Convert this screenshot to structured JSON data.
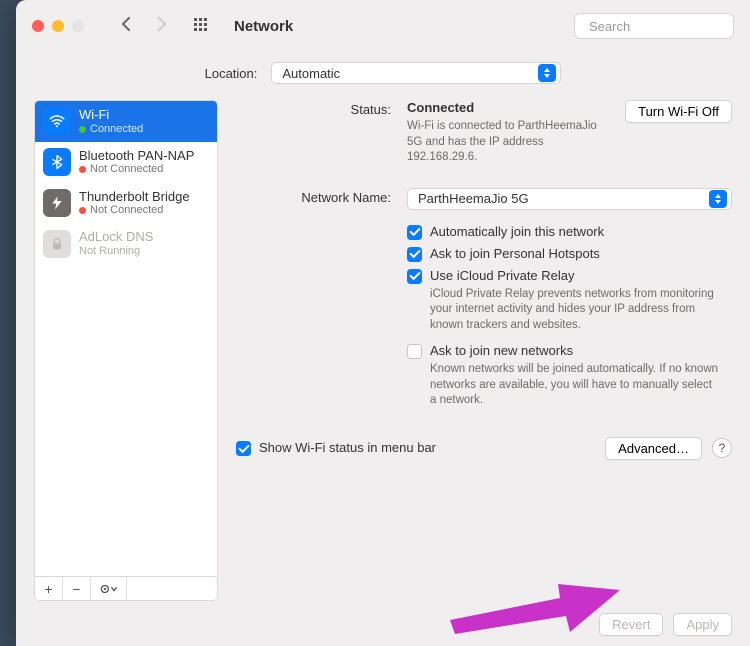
{
  "window": {
    "title": "Network",
    "search_placeholder": "Search"
  },
  "location": {
    "label": "Location:",
    "value": "Automatic"
  },
  "sidebar": {
    "items": [
      {
        "name": "Wi-Fi",
        "status": "Connected",
        "status_color": "green",
        "icon": "wifi",
        "icon_bg": "#0a7bff",
        "selected": true
      },
      {
        "name": "Bluetooth PAN-NAP",
        "status": "Not Connected",
        "status_color": "red",
        "icon": "bluetooth",
        "icon_bg": "#0a7bff"
      },
      {
        "name": "Thunderbolt Bridge",
        "status": "Not Connected",
        "status_color": "red",
        "icon": "thunderbolt",
        "icon_bg": "#6e6c6a"
      },
      {
        "name": "AdLock DNS",
        "status": "Not Running",
        "status_color": "none",
        "icon": "lock",
        "icon_bg": "#d6d4d2",
        "dim": true
      }
    ],
    "footer": {
      "add": "+",
      "remove": "−",
      "menu": "⊙⌄"
    }
  },
  "status": {
    "label": "Status:",
    "value": "Connected",
    "button": "Turn Wi-Fi Off",
    "desc": "Wi-Fi is connected to ParthHeemaJio 5G and has the IP address 192.168.29.6."
  },
  "network_name": {
    "label": "Network Name:",
    "value": "ParthHeemaJio 5G"
  },
  "checks": {
    "auto_join": {
      "label": "Automatically join this network",
      "checked": true
    },
    "ask_hotspot": {
      "label": "Ask to join Personal Hotspots",
      "checked": true
    },
    "icloud_relay": {
      "label": "Use iCloud Private Relay",
      "checked": true,
      "desc": "iCloud Private Relay prevents networks from monitoring your internet activity and hides your IP address from known trackers and websites."
    },
    "ask_new": {
      "label": "Ask to join new networks",
      "checked": false,
      "desc": "Known networks will be joined automatically. If no known networks are available, you will have to manually select a network."
    }
  },
  "menubar": {
    "show": {
      "label": "Show Wi-Fi status in menu bar",
      "checked": true
    }
  },
  "buttons": {
    "advanced": "Advanced…",
    "help": "?",
    "revert": "Revert",
    "apply": "Apply"
  }
}
